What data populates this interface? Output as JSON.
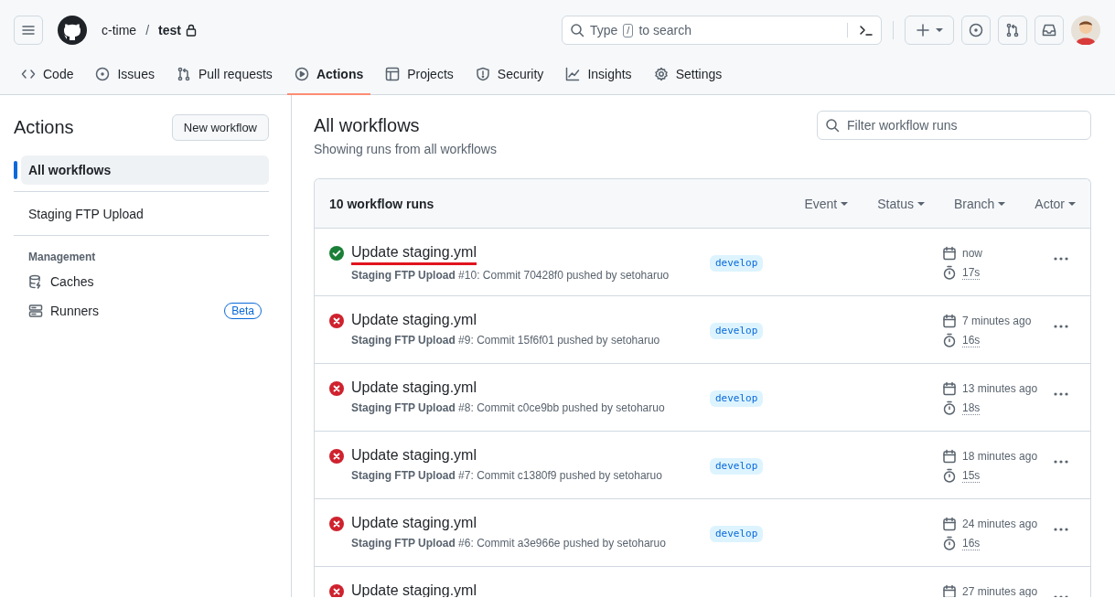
{
  "header": {
    "owner": "c-time",
    "separator": "/",
    "repo": "test",
    "search": {
      "before": "Type",
      "key": "/",
      "after": "to search"
    }
  },
  "tabs": [
    {
      "label": "Code",
      "selected": false
    },
    {
      "label": "Issues",
      "selected": false
    },
    {
      "label": "Pull requests",
      "selected": false
    },
    {
      "label": "Actions",
      "selected": true
    },
    {
      "label": "Projects",
      "selected": false
    },
    {
      "label": "Security",
      "selected": false
    },
    {
      "label": "Insights",
      "selected": false
    },
    {
      "label": "Settings",
      "selected": false
    }
  ],
  "sidebar": {
    "title": "Actions",
    "button": "New workflow",
    "items": [
      {
        "label": "All workflows",
        "selected": true
      },
      {
        "label": "Staging FTP Upload",
        "selected": false
      }
    ],
    "management": {
      "heading": "Management",
      "items": [
        {
          "label": "Caches"
        },
        {
          "label": "Runners",
          "badge": "Beta"
        }
      ]
    }
  },
  "main": {
    "title": "All workflows",
    "subtitle": "Showing runs from all workflows",
    "filter": {
      "placeholder": "Filter workflow runs"
    },
    "runs_count": "10 workflow runs",
    "filters": [
      "Event",
      "Status",
      "Branch",
      "Actor"
    ],
    "runs": [
      {
        "kind": "success",
        "title": "Update staging.yml",
        "underlined": true,
        "detail": "**Staging FTP Upload** #10: Commit 70428f0 pushed by setoharuo",
        "branch": "develop",
        "time": "now",
        "duration": "17s"
      },
      {
        "kind": "failure",
        "title": "Update staging.yml",
        "underlined": false,
        "detail": "**Staging FTP Upload** #9: Commit 15f6f01 pushed by setoharuo",
        "branch": "develop",
        "time": "7 minutes ago",
        "duration": "16s"
      },
      {
        "kind": "failure",
        "title": "Update staging.yml",
        "underlined": false,
        "detail": "**Staging FTP Upload** #8: Commit c0ce9bb pushed by setoharuo",
        "branch": "develop",
        "time": "13 minutes ago",
        "duration": "18s"
      },
      {
        "kind": "failure",
        "title": "Update staging.yml",
        "underlined": false,
        "detail": "**Staging FTP Upload** #7: Commit c1380f9 pushed by setoharuo",
        "branch": "develop",
        "time": "18 minutes ago",
        "duration": "15s"
      },
      {
        "kind": "failure",
        "title": "Update staging.yml",
        "underlined": false,
        "detail": "**Staging FTP Upload** #6: Commit a3e966e pushed by setoharuo",
        "branch": "develop",
        "time": "24 minutes ago",
        "duration": "16s"
      },
      {
        "kind": "failure",
        "title": "Update staging.yml",
        "time": "27 minutes ago"
      }
    ]
  }
}
